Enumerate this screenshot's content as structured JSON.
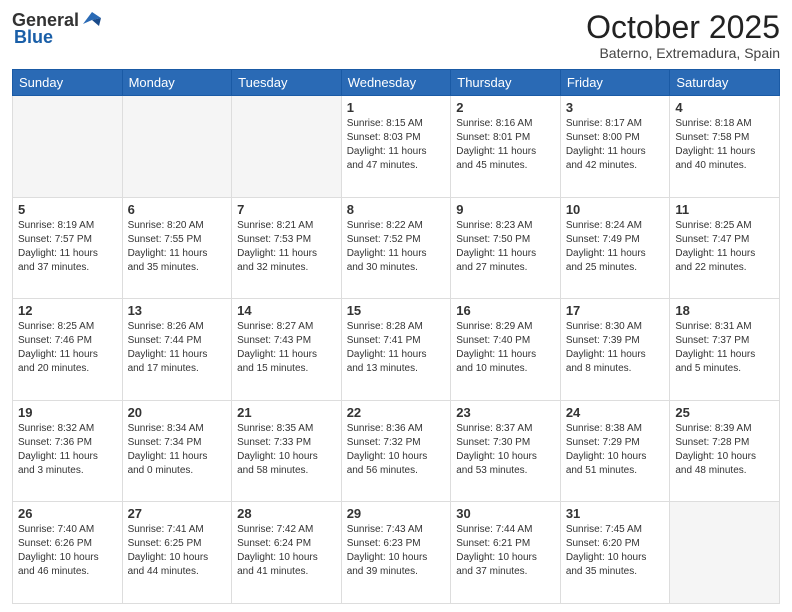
{
  "header": {
    "logo_general": "General",
    "logo_blue": "Blue",
    "month_title": "October 2025",
    "location": "Baterno, Extremadura, Spain"
  },
  "weekdays": [
    "Sunday",
    "Monday",
    "Tuesday",
    "Wednesday",
    "Thursday",
    "Friday",
    "Saturday"
  ],
  "days": [
    {
      "day": "",
      "info": ""
    },
    {
      "day": "",
      "info": ""
    },
    {
      "day": "",
      "info": ""
    },
    {
      "day": "1",
      "info": "Sunrise: 8:15 AM\nSunset: 8:03 PM\nDaylight: 11 hours\nand 47 minutes."
    },
    {
      "day": "2",
      "info": "Sunrise: 8:16 AM\nSunset: 8:01 PM\nDaylight: 11 hours\nand 45 minutes."
    },
    {
      "day": "3",
      "info": "Sunrise: 8:17 AM\nSunset: 8:00 PM\nDaylight: 11 hours\nand 42 minutes."
    },
    {
      "day": "4",
      "info": "Sunrise: 8:18 AM\nSunset: 7:58 PM\nDaylight: 11 hours\nand 40 minutes."
    },
    {
      "day": "5",
      "info": "Sunrise: 8:19 AM\nSunset: 7:57 PM\nDaylight: 11 hours\nand 37 minutes."
    },
    {
      "day": "6",
      "info": "Sunrise: 8:20 AM\nSunset: 7:55 PM\nDaylight: 11 hours\nand 35 minutes."
    },
    {
      "day": "7",
      "info": "Sunrise: 8:21 AM\nSunset: 7:53 PM\nDaylight: 11 hours\nand 32 minutes."
    },
    {
      "day": "8",
      "info": "Sunrise: 8:22 AM\nSunset: 7:52 PM\nDaylight: 11 hours\nand 30 minutes."
    },
    {
      "day": "9",
      "info": "Sunrise: 8:23 AM\nSunset: 7:50 PM\nDaylight: 11 hours\nand 27 minutes."
    },
    {
      "day": "10",
      "info": "Sunrise: 8:24 AM\nSunset: 7:49 PM\nDaylight: 11 hours\nand 25 minutes."
    },
    {
      "day": "11",
      "info": "Sunrise: 8:25 AM\nSunset: 7:47 PM\nDaylight: 11 hours\nand 22 minutes."
    },
    {
      "day": "12",
      "info": "Sunrise: 8:25 AM\nSunset: 7:46 PM\nDaylight: 11 hours\nand 20 minutes."
    },
    {
      "day": "13",
      "info": "Sunrise: 8:26 AM\nSunset: 7:44 PM\nDaylight: 11 hours\nand 17 minutes."
    },
    {
      "day": "14",
      "info": "Sunrise: 8:27 AM\nSunset: 7:43 PM\nDaylight: 11 hours\nand 15 minutes."
    },
    {
      "day": "15",
      "info": "Sunrise: 8:28 AM\nSunset: 7:41 PM\nDaylight: 11 hours\nand 13 minutes."
    },
    {
      "day": "16",
      "info": "Sunrise: 8:29 AM\nSunset: 7:40 PM\nDaylight: 11 hours\nand 10 minutes."
    },
    {
      "day": "17",
      "info": "Sunrise: 8:30 AM\nSunset: 7:39 PM\nDaylight: 11 hours\nand 8 minutes."
    },
    {
      "day": "18",
      "info": "Sunrise: 8:31 AM\nSunset: 7:37 PM\nDaylight: 11 hours\nand 5 minutes."
    },
    {
      "day": "19",
      "info": "Sunrise: 8:32 AM\nSunset: 7:36 PM\nDaylight: 11 hours\nand 3 minutes."
    },
    {
      "day": "20",
      "info": "Sunrise: 8:34 AM\nSunset: 7:34 PM\nDaylight: 11 hours\nand 0 minutes."
    },
    {
      "day": "21",
      "info": "Sunrise: 8:35 AM\nSunset: 7:33 PM\nDaylight: 10 hours\nand 58 minutes."
    },
    {
      "day": "22",
      "info": "Sunrise: 8:36 AM\nSunset: 7:32 PM\nDaylight: 10 hours\nand 56 minutes."
    },
    {
      "day": "23",
      "info": "Sunrise: 8:37 AM\nSunset: 7:30 PM\nDaylight: 10 hours\nand 53 minutes."
    },
    {
      "day": "24",
      "info": "Sunrise: 8:38 AM\nSunset: 7:29 PM\nDaylight: 10 hours\nand 51 minutes."
    },
    {
      "day": "25",
      "info": "Sunrise: 8:39 AM\nSunset: 7:28 PM\nDaylight: 10 hours\nand 48 minutes."
    },
    {
      "day": "26",
      "info": "Sunrise: 7:40 AM\nSunset: 6:26 PM\nDaylight: 10 hours\nand 46 minutes."
    },
    {
      "day": "27",
      "info": "Sunrise: 7:41 AM\nSunset: 6:25 PM\nDaylight: 10 hours\nand 44 minutes."
    },
    {
      "day": "28",
      "info": "Sunrise: 7:42 AM\nSunset: 6:24 PM\nDaylight: 10 hours\nand 41 minutes."
    },
    {
      "day": "29",
      "info": "Sunrise: 7:43 AM\nSunset: 6:23 PM\nDaylight: 10 hours\nand 39 minutes."
    },
    {
      "day": "30",
      "info": "Sunrise: 7:44 AM\nSunset: 6:21 PM\nDaylight: 10 hours\nand 37 minutes."
    },
    {
      "day": "31",
      "info": "Sunrise: 7:45 AM\nSunset: 6:20 PM\nDaylight: 10 hours\nand 35 minutes."
    },
    {
      "day": "",
      "info": ""
    }
  ]
}
